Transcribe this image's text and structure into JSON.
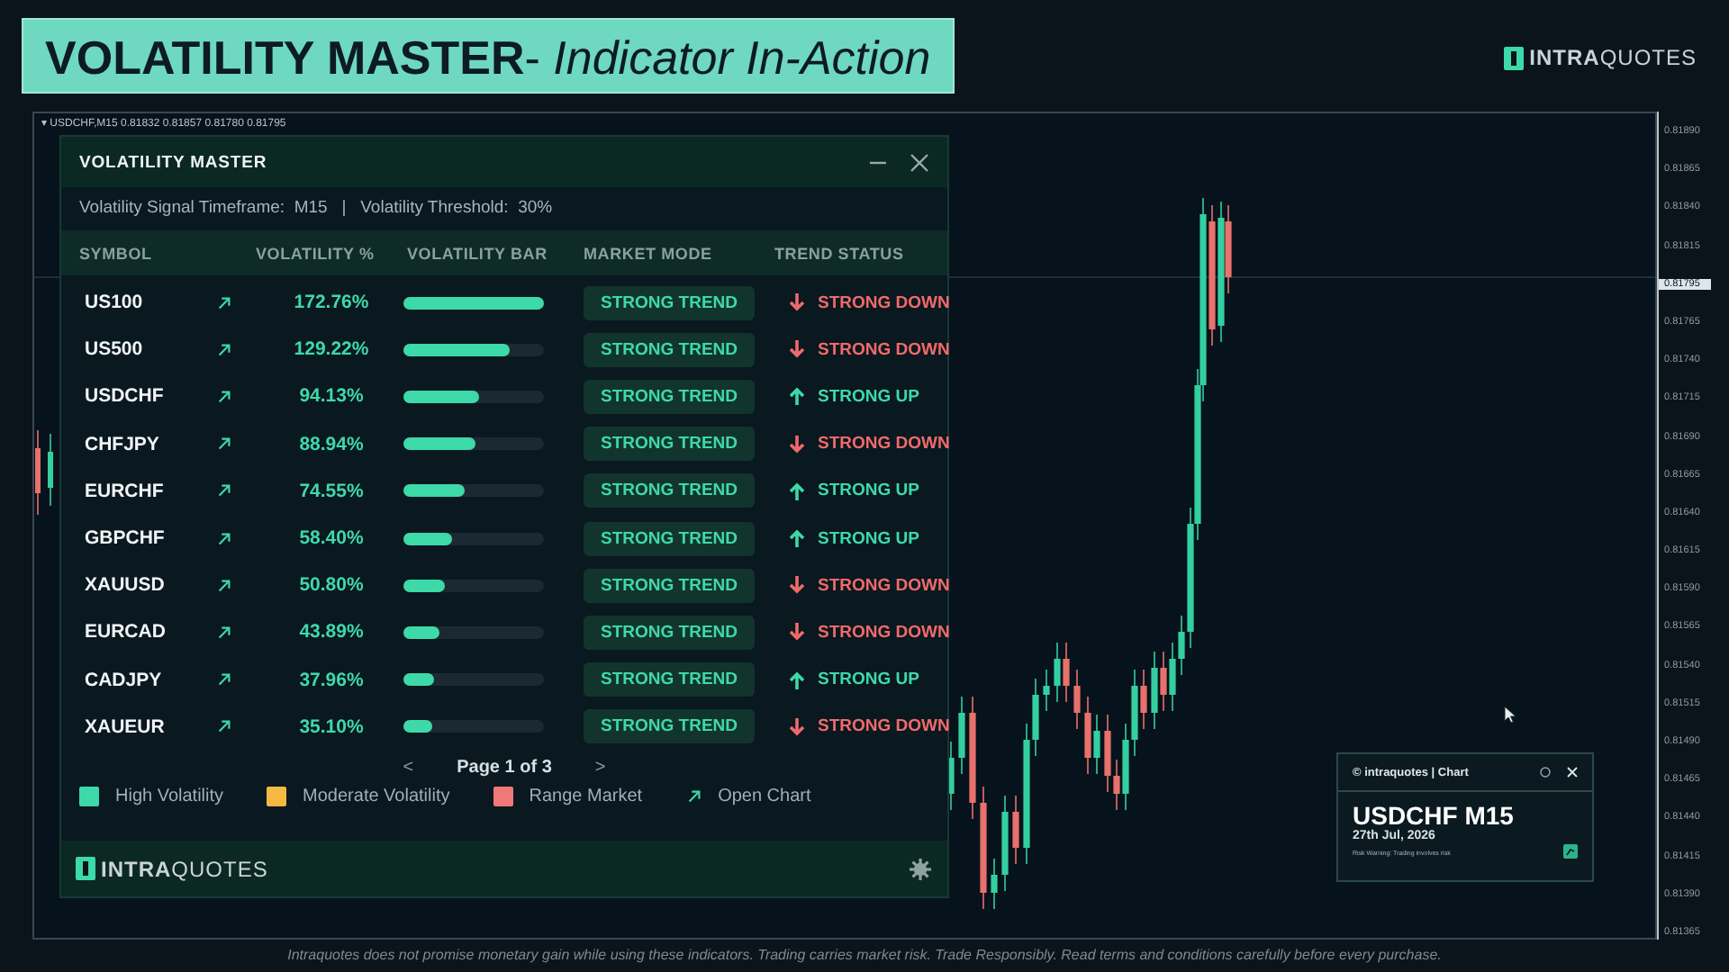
{
  "banner": {
    "title": "**VOLATILITY MASTER**- *Indicator In-Action*"
  },
  "brand": {
    "logo": "**INTRA**QUOTES"
  },
  "chart": {
    "collapse": "▾",
    "info": "USDCHF,M15  0.81832 0.81857 0.81780 0.81795",
    "price_axis": [
      {
        "label": "0.81890",
        "current": false
      },
      {
        "label": "0.81865",
        "current": false
      },
      {
        "label": "0.81840",
        "current": false
      },
      {
        "label": "0.81815",
        "current": false
      },
      {
        "label": "0.81795",
        "current": true
      },
      {
        "label": "0.81765",
        "current": false
      },
      {
        "label": "0.81740",
        "current": false
      },
      {
        "label": "0.81715",
        "current": false
      },
      {
        "label": "0.81690",
        "current": false
      },
      {
        "label": "0.81665",
        "current": false
      },
      {
        "label": "0.81640",
        "current": false
      },
      {
        "label": "0.81615",
        "current": false
      },
      {
        "label": "0.81590",
        "current": false
      },
      {
        "label": "0.81565",
        "current": false
      },
      {
        "label": "0.81540",
        "current": false
      },
      {
        "label": "0.81515",
        "current": false
      },
      {
        "label": "0.81490",
        "current": false
      },
      {
        "label": "0.81465",
        "current": false
      },
      {
        "label": "0.81440",
        "current": false
      },
      {
        "label": "0.81415",
        "current": false
      },
      {
        "label": "0.81390",
        "current": false
      },
      {
        "label": "0.81365",
        "current": false
      }
    ]
  },
  "panel": {
    "title": "VOLATILITY MASTER",
    "settings": "Volatility Signal Timeframe:  M15   |   Volatility Threshold:  30%",
    "columns": [
      "SYMBOL",
      "VOLATILITY %",
      "VOLATILITY BAR",
      "MARKET MODE",
      "TREND STATUS"
    ],
    "rows": [
      {
        "symbol": "US100",
        "volatility": "172.76%",
        "level": 1.0,
        "mode": "STRONG TREND",
        "trend": "STRONG DOWN",
        "kind": "down"
      },
      {
        "symbol": "US500",
        "volatility": "129.22%",
        "level": 0.75,
        "mode": "STRONG TREND",
        "trend": "STRONG DOWN",
        "kind": "down"
      },
      {
        "symbol": "USDCHF",
        "volatility": "94.13%",
        "level": 0.54,
        "mode": "STRONG TREND",
        "trend": "STRONG UP",
        "kind": "up"
      },
      {
        "symbol": "CHFJPY",
        "volatility": "88.94%",
        "level": 0.51,
        "mode": "STRONG TREND",
        "trend": "STRONG DOWN",
        "kind": "down"
      },
      {
        "symbol": "EURCHF",
        "volatility": "74.55%",
        "level": 0.43,
        "mode": "STRONG TREND",
        "trend": "STRONG UP",
        "kind": "up"
      },
      {
        "symbol": "GBPCHF",
        "volatility": "58.40%",
        "level": 0.34,
        "mode": "STRONG TREND",
        "trend": "STRONG UP",
        "kind": "up"
      },
      {
        "symbol": "XAUUSD",
        "volatility": "50.80%",
        "level": 0.29,
        "mode": "STRONG TREND",
        "trend": "STRONG DOWN",
        "kind": "down"
      },
      {
        "symbol": "EURCAD",
        "volatility": "43.89%",
        "level": 0.26,
        "mode": "STRONG TREND",
        "trend": "STRONG DOWN",
        "kind": "down"
      },
      {
        "symbol": "CADJPY",
        "volatility": "37.96%",
        "level": 0.22,
        "mode": "STRONG TREND",
        "trend": "STRONG UP",
        "kind": "up"
      },
      {
        "symbol": "XAUEUR",
        "volatility": "35.10%",
        "level": 0.2,
        "mode": "STRONG TREND",
        "trend": "STRONG DOWN",
        "kind": "down"
      }
    ],
    "pagination": {
      "prev": "<",
      "label": "Page 1 of 3",
      "next": ">"
    },
    "legend": [
      {
        "label": "High Volatility",
        "kind": "swatch",
        "color": "#3dd9a8"
      },
      {
        "label": "Moderate Volatility",
        "kind": "swatch",
        "color": "#f5b942"
      },
      {
        "label": "Range Market",
        "kind": "swatch",
        "color": "#f07878"
      },
      {
        "label": "Open Chart",
        "kind": "arrow"
      }
    ],
    "footer_logo": "**INTRA**QUOTES"
  },
  "popup": {
    "title": "© intraquotes | Chart",
    "symbol": "USDCHF M15",
    "date": "27th Jul, 2026",
    "warning": "Risk Warning: Trading involves risk"
  },
  "disclaimer": "Intraquotes does not promise monetary gain while using these indicators. Trading carries market risk. Trade Responsibly. Read terms and conditions carefully before every purchase."
}
